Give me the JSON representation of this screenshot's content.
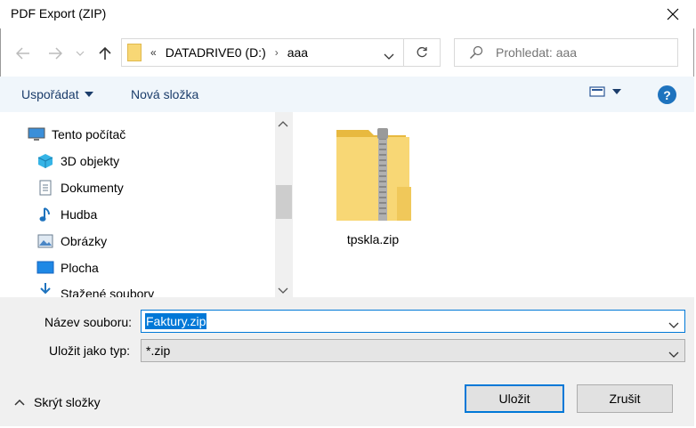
{
  "window": {
    "title": "PDF Export (ZIP)"
  },
  "address": {
    "overflow": "«",
    "path": [
      "DATADRIVE0 (D:)",
      "aaa"
    ]
  },
  "search": {
    "placeholder": "Prohledat: aaa"
  },
  "toolbar": {
    "organize": "Uspořádat",
    "new_folder": "Nová složka"
  },
  "nav": {
    "items": [
      {
        "label": "Tento počítač",
        "icon": "computer-icon"
      },
      {
        "label": "3D objekty",
        "icon": "cube-icon"
      },
      {
        "label": "Dokumenty",
        "icon": "document-icon"
      },
      {
        "label": "Hudba",
        "icon": "music-icon"
      },
      {
        "label": "Obrázky",
        "icon": "pictures-icon"
      },
      {
        "label": "Plocha",
        "icon": "desktop-icon"
      },
      {
        "label": "Stažené soubory",
        "icon": "download-icon"
      }
    ]
  },
  "files": [
    {
      "name": "tpskla.zip",
      "icon": "zip-folder-icon"
    }
  ],
  "form": {
    "filename_label": "Název souboru:",
    "filename_value": "Faktury.zip",
    "type_label": "Uložit jako typ:",
    "type_value": "*.zip"
  },
  "footer": {
    "hide_folders": "Skrýt složky",
    "save": "Uložit",
    "cancel": "Zrušit"
  },
  "colors": {
    "accent": "#0078d7",
    "toolbar_bg": "#f0f6fb",
    "footer_bg": "#f0f0f0",
    "help": "#1e73be"
  }
}
